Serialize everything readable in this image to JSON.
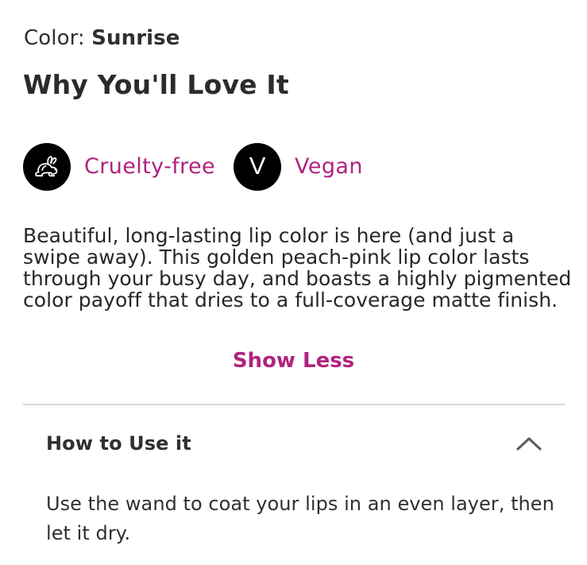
{
  "color": {
    "label": "Color:",
    "value": "Sunrise"
  },
  "why_section": {
    "heading": "Why You'll Love It",
    "badges": [
      {
        "icon": "rabbit-icon",
        "label": "Cruelty-free"
      },
      {
        "icon": "vegan-v-icon",
        "icon_text": "V",
        "label": "Vegan"
      }
    ],
    "description": "Beautiful, long-lasting lip color is here (and just a swipe away). This golden peach-pink lip color lasts through your busy day, and boasts a highly pigmented color payoff that dries to a full-coverage matte finish.",
    "toggle_label": "Show Less"
  },
  "accordion": {
    "title": "How to Use it",
    "expanded": true,
    "body": "Use the wand to coat your lips in an even layer, then let it dry."
  },
  "colors": {
    "accent": "#b0237f",
    "text": "#2b2b2b",
    "divider": "#d8d8d8",
    "badge_background": "#000000"
  }
}
